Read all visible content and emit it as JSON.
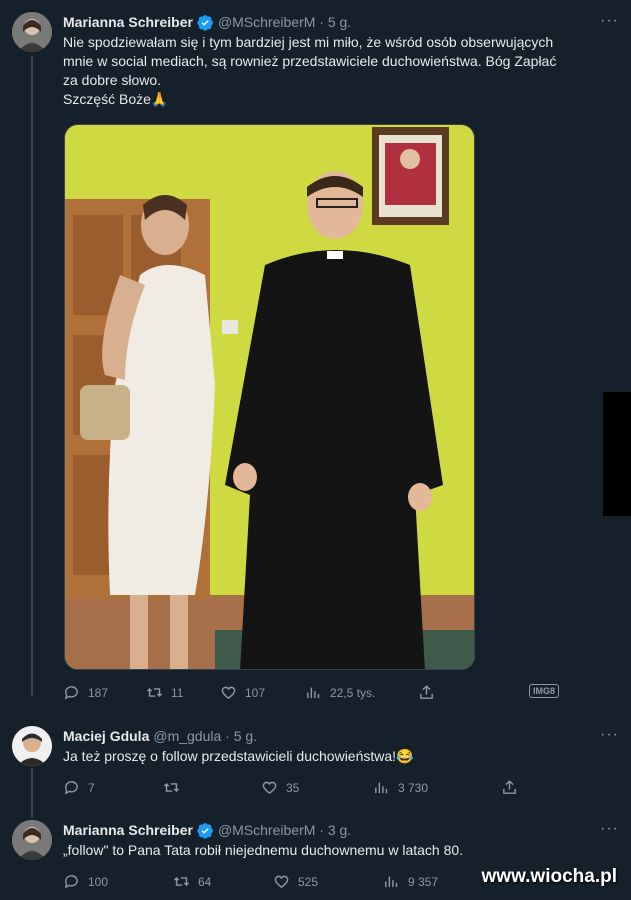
{
  "tweets": [
    {
      "name": "Marianna Schreiber",
      "handle": "@MSchreiberM · 5 g.",
      "verified": true,
      "text_lines": [
        "Nie spodziewałam się i tym bardziej jest mi miło, że wśród osób obserwujących",
        "mnie w social mediach, są rownież przedstawiciele duchowieństwa. Bóg Zapłać",
        "za dobre słowo.",
        "Szczęść Boże🙏"
      ],
      "replies": "187",
      "retweets": "11",
      "likes": "107",
      "views": "22,5 tys.",
      "badge": "IMG8"
    },
    {
      "name": "Maciej Gdula",
      "handle": "@m_gdula · 5 g.",
      "verified": false,
      "text_lines": [
        "Ja też proszę o follow przedstawicieli duchowieństwa!😂"
      ],
      "replies": "7",
      "retweets": "",
      "likes": "35",
      "views": "3 730"
    },
    {
      "name": "Marianna Schreiber",
      "handle": "@MSchreiberM · 3 g.",
      "verified": true,
      "text_lines": [
        "„follow\" to Pana Tata robił niejednemu duchownemu w latach 80."
      ],
      "replies": "100",
      "retweets": "64",
      "likes": "525",
      "views": "9 357"
    }
  ],
  "more_label": "···",
  "watermark": "www.wiocha.pl",
  "colors": {
    "background": "#15202b",
    "verified": "#1d9bf0",
    "muted": "#8b98a5"
  }
}
